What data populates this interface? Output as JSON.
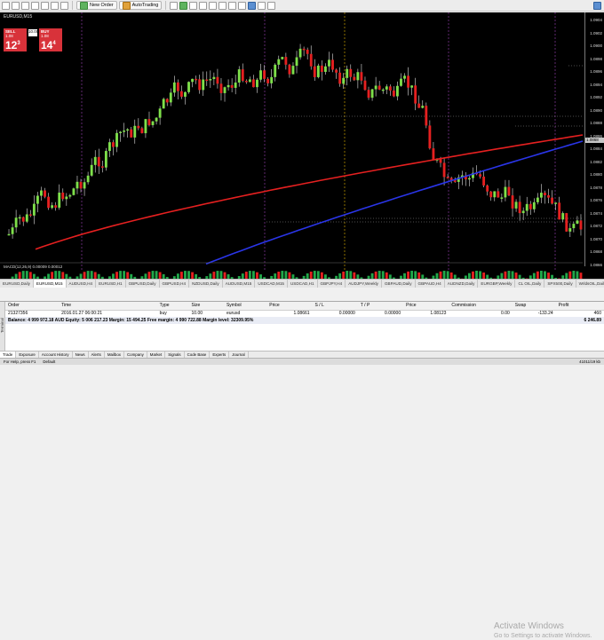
{
  "toolbar": {
    "new_order_label": "New Order",
    "autotrading_label": "AutoTrading"
  },
  "chart": {
    "symbol_title": "EURUSD,M15",
    "price_labels": [
      "1.0904",
      "1.0902",
      "1.0900",
      "1.0898",
      "1.0896",
      "1.0894",
      "1.0892",
      "1.0890",
      "1.0888",
      "1.0886",
      "1.0884",
      "1.0882",
      "1.0880",
      "1.0878",
      "1.0876",
      "1.0874",
      "1.0872",
      "1.0870",
      "1.0868",
      "1.0866"
    ],
    "bid_mark": "1.0868",
    "indicator_label": "MACD(12,26,9) 0.00009 0.00012",
    "time_labels": [
      "2 Feb 2016",
      "1 Feb 19:00",
      "1 Feb 20:30",
      "1 Feb 22:00",
      "1 Feb 23:30",
      "2 Feb 01:00",
      "2 Feb 02:30",
      "2 Feb 04:00",
      "2 Feb 05:30",
      "2 Feb 07:00",
      "2 Feb 08:30",
      "2 Feb 10:00",
      "2 Feb 11:30",
      "2 Feb 13:00",
      "2 Feb 14:30",
      "2 Feb 16:00",
      "2 Feb 17:30",
      "2 Feb 19:00",
      "2 Feb 20:30",
      "2 Feb 22:00"
    ]
  },
  "one_click": {
    "sell_label": "SELL",
    "buy_label": "BUY",
    "volume": "10.00",
    "sell_price_small": "1.08",
    "sell_price_big": "12",
    "sell_price_sup": "3",
    "buy_price_small": "1.08",
    "buy_price_big": "14",
    "buy_price_sup": "4"
  },
  "chart_tabs": [
    "EURUSD,Daily",
    "EURUSD,M15",
    "AUDUSD,H4",
    "EURUSD,H1",
    "GBPUSD,Daily",
    "GBPUSD,H4",
    "NZDUSD,Daily",
    "AUDUSD,M15",
    "USDCAD,M15",
    "USDCAD,H1",
    "GBPJPY,H4",
    "AUDJPY,Weekly",
    "GBPAUD,Daily",
    "GBPAUD,H4",
    "AUDNZD,Daily",
    "EURGBP,Weekly",
    "CL OIL,Daily",
    "SPX500,Daily",
    "WrldsOIL,Daily",
    "CHINA50,M15",
    "HKD,Weekly"
  ],
  "terminal": {
    "handle_label": "Terminal",
    "columns": [
      "Order",
      "Time",
      "Type",
      "Size",
      "Symbol",
      "Price",
      "S / L",
      "T / P",
      "Price",
      "Commission",
      "Swap",
      "Profit"
    ],
    "rows": [
      [
        "21327356",
        "2016.01.27 06:00:21",
        "buy",
        "10.00",
        "eurusd",
        "1.08661",
        "0.00000",
        "0.00000",
        "1.08123",
        "0.00",
        "-133.24",
        "460"
      ]
    ],
    "balance_text": "Balance: 4 999 972.18 AUD  Equity: 5 006 217.23  Margin: 15 494.25  Free margin: 4 990 722.88  Margin level: 32309.95%",
    "balance_profit": "6 246.89"
  },
  "watermark": {
    "title": "Activate Windows",
    "subtitle": "Go to Settings to activate Windows."
  },
  "bottom_tabs": [
    "Trade",
    "Exposure",
    "Account History",
    "News",
    "Alerts",
    "Mailbox",
    "Company",
    "Market",
    "Signals",
    "Code Base",
    "Experts",
    "Journal"
  ],
  "status": {
    "left": "For Help, press F1",
    "mid": "Default",
    "right": "41011/19 kb"
  }
}
